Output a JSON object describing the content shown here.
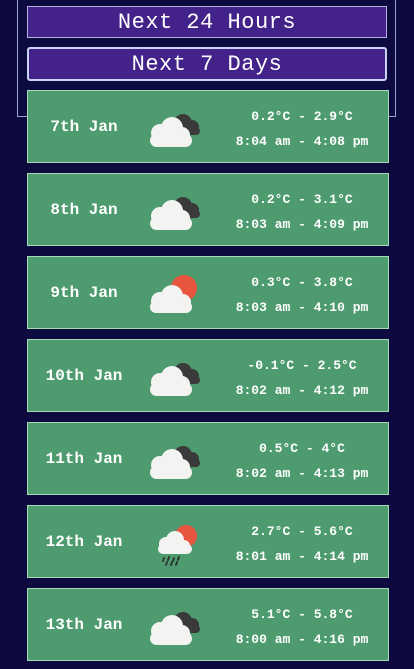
{
  "tabs": {
    "next_24_hours": "Next 24 Hours",
    "next_7_days": "Next 7 Days"
  },
  "days": [
    {
      "date": "7th Jan",
      "temp": "0.2°C - 2.9°C",
      "daylight": "8:04 am - 4:08 pm",
      "icon": "cloud-dark-cloud"
    },
    {
      "date": "8th Jan",
      "temp": "0.2°C - 3.1°C",
      "daylight": "8:03 am - 4:09 pm",
      "icon": "cloud-dark-cloud"
    },
    {
      "date": "9th Jan",
      "temp": "0.3°C - 3.8°C",
      "daylight": "8:03 am - 4:10 pm",
      "icon": "sun-behind-cloud"
    },
    {
      "date": "10th Jan",
      "temp": "-0.1°C - 2.5°C",
      "daylight": "8:02 am - 4:12 pm",
      "icon": "cloud-dark-cloud"
    },
    {
      "date": "11th Jan",
      "temp": "0.5°C - 4°C",
      "daylight": "8:02 am - 4:13 pm",
      "icon": "cloud-dark-cloud"
    },
    {
      "date": "12th Jan",
      "temp": "2.7°C - 5.6°C",
      "daylight": "8:01 am - 4:14 pm",
      "icon": "sun-cloud-rain"
    },
    {
      "date": "13th Jan",
      "temp": "5.1°C - 5.8°C",
      "daylight": "8:00 am - 4:16 pm",
      "icon": "cloud-dark-cloud"
    }
  ],
  "colors": {
    "background": "#0d0a3f",
    "tab": "#43228a",
    "card": "#4d9b6e",
    "sun": "#e8553f"
  }
}
